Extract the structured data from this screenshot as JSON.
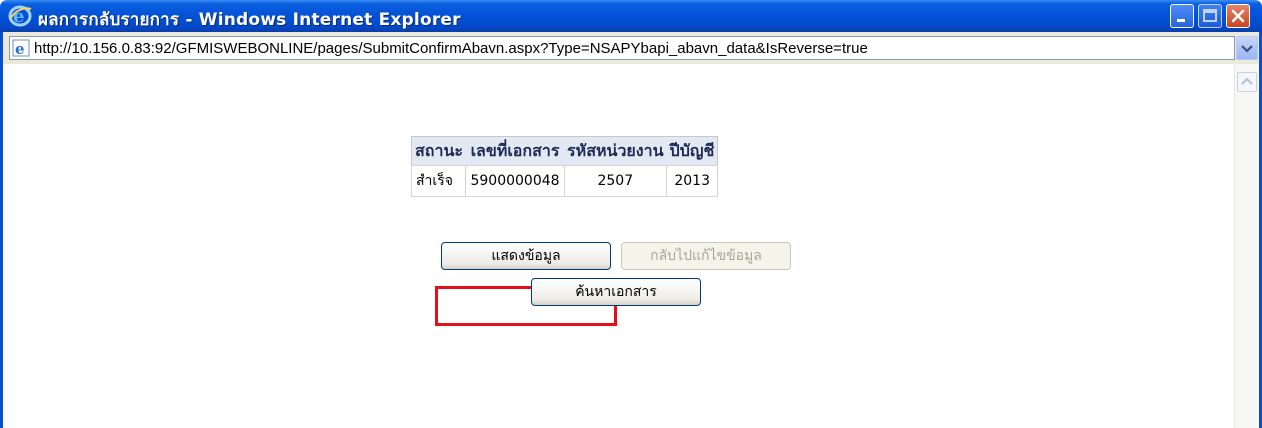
{
  "window": {
    "title": "ผลการกลับรายการ - Windows Internet Explorer",
    "address": "http://10.156.0.83:92/GFMISWEBONLINE/pages/SubmitConfirmAbavn.aspx?Type=NSAPYbapi_abavn_data&IsReverse=true",
    "icons": [
      "ie-logo-icon",
      "page-icon",
      "dropdown-arrow-icon"
    ]
  },
  "result_table": {
    "headers": [
      "สถานะ",
      "เลขที่เอกสาร",
      "รหัสหน่วยงาน",
      "ปีบัญชี"
    ],
    "rows": [
      [
        "สำเร็จ",
        "5900000048",
        "2507",
        "2013"
      ]
    ]
  },
  "buttons": {
    "show_data": "แสดงข้อมูล",
    "back_edit": "กลับไปแก้ไขข้อมูล",
    "search_doc": "ค้นหาเอกสาร"
  },
  "colors": {
    "titlebar": "#0553d8",
    "highlight": "#e3101a",
    "table_header_bg": "#e3e9f2"
  }
}
